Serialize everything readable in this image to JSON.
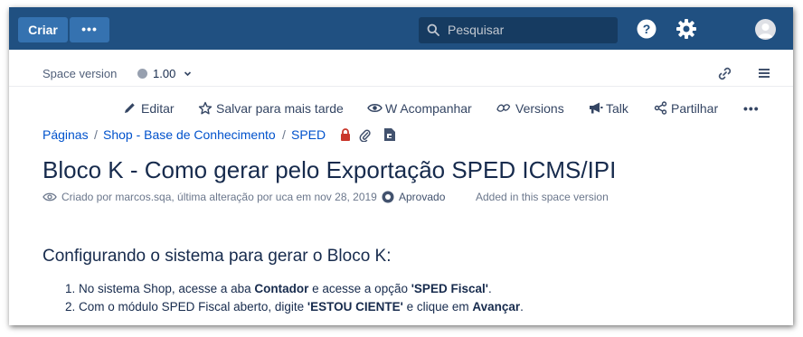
{
  "topnav": {
    "create_label": "Criar",
    "more_label": "•••",
    "search_placeholder": "Pesquisar",
    "colors": {
      "bar": "#205081",
      "button": "#3572b0",
      "search_bg": "#163b61"
    }
  },
  "space": {
    "label": "Space version",
    "version": "1.00"
  },
  "actions": [
    {
      "label": "Editar",
      "icon": "pencil-icon"
    },
    {
      "label": "Salvar para mais tarde",
      "icon": "star-icon"
    },
    {
      "label": "W Acompanhar",
      "icon": "eye-icon"
    },
    {
      "label": "Versions",
      "icon": "versions-icon"
    },
    {
      "label": "Talk",
      "icon": "megaphone-icon"
    },
    {
      "label": "Partilhar",
      "icon": "share-icon"
    },
    {
      "label": "•••",
      "icon": "more-icon"
    }
  ],
  "breadcrumb": [
    "Páginas",
    "Shop - Base de Conhecimento",
    "SPED"
  ],
  "page": {
    "title": "Bloco K - Como gerar pelo Exportação SPED ICMS/IPI",
    "meta_created": "Criado por marcos.sqa, última alteração por uca em nov 28, 2019",
    "status": "Aprovado",
    "space_note": "Added in this space version"
  },
  "content": {
    "heading": "Configurando o sistema para gerar o Bloco K:",
    "steps": [
      {
        "n": "1.",
        "t1": "No sistema Shop, acesse a aba ",
        "b1": "Contador",
        "t2": "  e acesse a opção ",
        "b2": "'SPED Fiscal'",
        "t3": "."
      },
      {
        "n": "2.",
        "t1": "Com o módulo SPED Fiscal aberto, digite ",
        "b1": "'ESTOU CIENTE'",
        "t2": " e clique em ",
        "b2": "Avançar",
        "t3": "."
      }
    ]
  }
}
